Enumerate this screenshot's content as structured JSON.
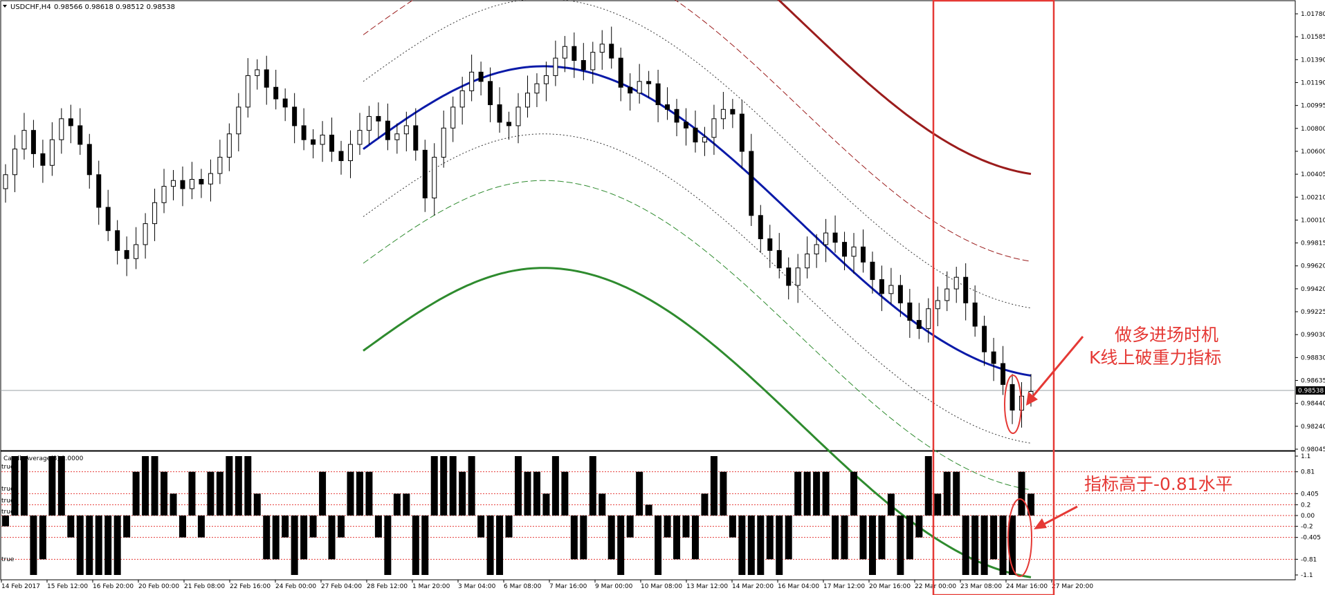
{
  "header": {
    "symbol": "USDCHF,H4",
    "ohlc": "0.98566 0.98618 0.98512 0.98538"
  },
  "indicator": {
    "name": "CandleAverage(3) 1.0000",
    "true_label": "true"
  },
  "price_axis": {
    "ticks": [
      "1.01780",
      "1.01585",
      "1.01390",
      "1.01190",
      "1.00995",
      "1.00800",
      "1.00600",
      "1.00405",
      "1.00210",
      "1.00010",
      "0.99815",
      "0.99620",
      "0.99420",
      "0.99225",
      "0.99030",
      "0.98830",
      "0.98635",
      "0.98440",
      "0.98240",
      "0.98045"
    ],
    "current_price": "0.98538"
  },
  "indicator_axis": {
    "ticks": [
      "1.1",
      "0.81",
      "0.405",
      "0.2",
      "0.00",
      "-0.2",
      "-0.405",
      "-0.81",
      "-1.1"
    ]
  },
  "time_axis": {
    "ticks": [
      "14 Feb 2017",
      "15 Feb 12:00",
      "16 Feb 20:00",
      "20 Feb 00:00",
      "21 Feb 08:00",
      "22 Feb 16:00",
      "24 Feb 00:00",
      "27 Feb 04:00",
      "28 Feb 12:00",
      "1 Mar 20:00",
      "3 Mar 04:00",
      "6 Mar 08:00",
      "7 Mar 16:00",
      "9 Mar 00:00",
      "10 Mar 08:00",
      "13 Mar 12:00",
      "14 Mar 20:00",
      "16 Mar 04:00",
      "17 Mar 12:00",
      "20 Mar 16:00",
      "22 Mar 00:00",
      "23 Mar 08:00",
      "24 Mar 16:00",
      "27 Mar 20:00"
    ]
  },
  "annotations": {
    "entry_line1": "做多进场时机",
    "entry_line2": "K线上破重力指标",
    "indicator_note": "指标高于-0.81水平"
  },
  "colors": {
    "upper_band": "#9b1c1c",
    "lower_band": "#2e8b2e",
    "center_line": "#0a1aa8",
    "highlight": "#e53935"
  },
  "chart_data": {
    "type": "candlestick",
    "title": "USDCHF,H4",
    "ylim": [
      0.98045,
      1.0178
    ],
    "indicator_levels": [
      1.1,
      0.81,
      0.405,
      0.2,
      0.0,
      -0.2,
      -0.405,
      -0.81,
      -1.1
    ],
    "series": [
      {
        "name": "close",
        "values": [
          1.004,
          1.0062,
          1.0078,
          1.0058,
          1.0048,
          1.007,
          1.0088,
          1.0082,
          1.0066,
          1.004,
          1.0012,
          0.9992,
          0.9975,
          0.9968,
          0.998,
          0.9998,
          1.0016,
          1.003,
          1.0035,
          1.0028,
          1.0036,
          1.0032,
          1.0041,
          1.0055,
          1.0075,
          1.0098,
          1.0125,
          1.013,
          1.0115,
          1.0105,
          1.0098,
          1.0082,
          1.007,
          1.0066,
          1.0074,
          1.006,
          1.0052,
          1.0066,
          1.0078,
          1.009,
          1.0086,
          1.007,
          1.0075,
          1.0082,
          1.0061,
          1.002,
          1.0055,
          1.008,
          1.0098,
          1.0112,
          1.0128,
          1.012,
          1.01,
          1.0085,
          1.0082,
          1.0098,
          1.011,
          1.0118,
          1.0125,
          1.014,
          1.015,
          1.0138,
          1.013,
          1.0145,
          1.0152,
          1.014,
          1.0115,
          1.011,
          1.012,
          1.0118,
          1.01,
          1.0096,
          1.0085,
          1.008,
          1.0068,
          1.0072,
          1.0088,
          1.0096,
          1.0092,
          1.006,
          1.0005,
          0.9985,
          0.9975,
          0.996,
          0.9945,
          0.996,
          0.9972,
          0.998,
          0.999,
          0.9982,
          0.997,
          0.9978,
          0.9965,
          0.995,
          0.9938,
          0.9945,
          0.993,
          0.9915,
          0.9908,
          0.9925,
          0.9932,
          0.9942,
          0.9952,
          0.993,
          0.991,
          0.9888,
          0.9878,
          0.986,
          0.9838,
          0.985,
          0.9854
        ]
      }
    ]
  }
}
